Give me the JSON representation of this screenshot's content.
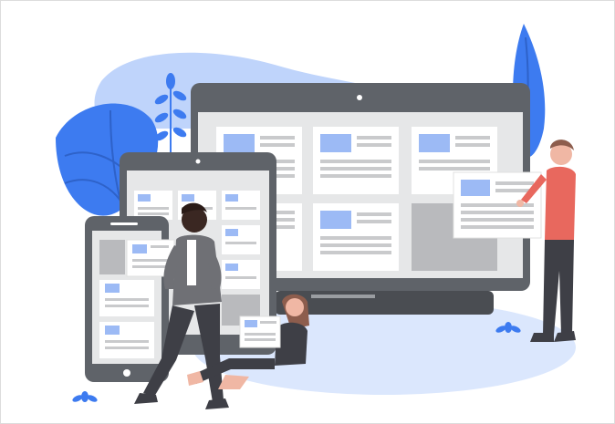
{
  "illustration": {
    "subject": "responsive-web-design",
    "colors": {
      "accent_blue": "#3d7bf0",
      "light_blue": "#bfd4fb",
      "pale_blue": "#dbe7fd",
      "device_dark": "#5f6369",
      "screen_gray": "#e6e7e8",
      "card": "#ffffff",
      "line_gray": "#c9cacc",
      "skin_dark": "#3a2722",
      "hair_brown": "#8d5d4d",
      "shirt_red": "#e8685e",
      "jacket_gray": "#6f7075",
      "pants_dark": "#3e3f46"
    },
    "devices": [
      "monitor",
      "tablet",
      "phone"
    ],
    "people": [
      "man-standing-left",
      "woman-sitting",
      "man-standing-right"
    ],
    "plants": [
      "plant-left",
      "plant-right",
      "leaf-top"
    ]
  }
}
